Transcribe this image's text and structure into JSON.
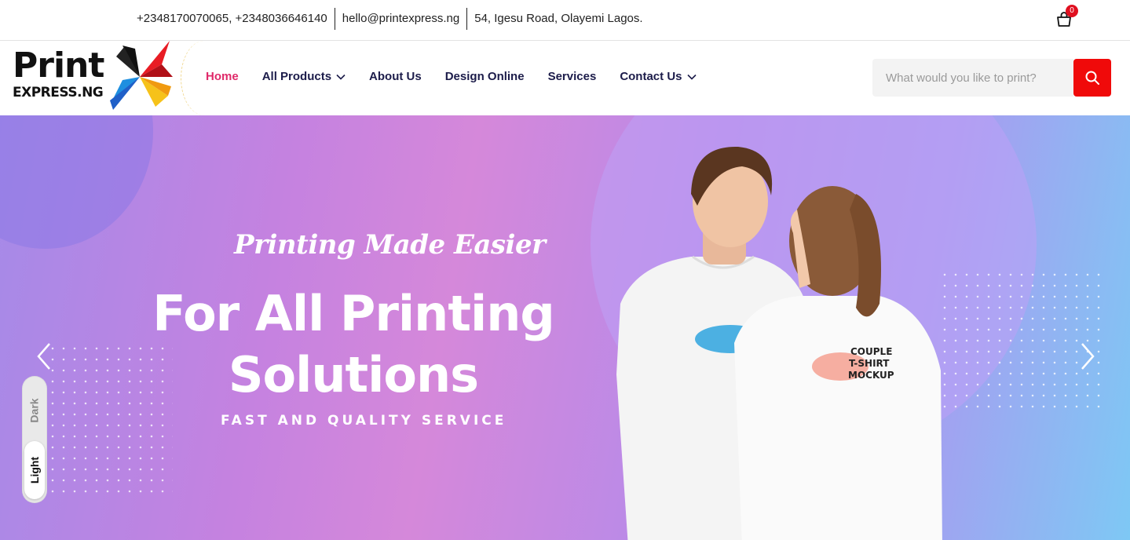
{
  "topbar": {
    "phones": "+2348170070065, +2348036646140",
    "email": "hello@printexpress.ng",
    "address": "54, Igesu Road, Olayemi Lagos.",
    "cart_count": "0"
  },
  "logo": {
    "line1": "Print",
    "line2": "EXPRESS.NG"
  },
  "nav": {
    "items": [
      {
        "label": "Home",
        "active": true,
        "dropdown": false
      },
      {
        "label": "All Products",
        "active": false,
        "dropdown": true
      },
      {
        "label": "About Us",
        "active": false,
        "dropdown": false
      },
      {
        "label": "Design Online",
        "active": false,
        "dropdown": false
      },
      {
        "label": "Services",
        "active": false,
        "dropdown": false
      },
      {
        "label": "Contact Us",
        "active": false,
        "dropdown": true
      }
    ]
  },
  "search": {
    "placeholder": "What would you like to print?"
  },
  "hero": {
    "tagline": "Printing Made Easier",
    "headline_line1": "For All Printing",
    "headline_line2": "Solutions",
    "subline": "FAST AND QUALITY SERVICE",
    "shirt_text_line1": "COUPLE",
    "shirt_text_line2": "T-SHIRT",
    "shirt_text_line3": "MOCKUP"
  },
  "theme_toggle": {
    "dark_label": "Dark",
    "light_label": "Light"
  },
  "colors": {
    "accent_red": "#f00a0a",
    "nav_active": "#e02a6a",
    "nav_text": "#1c1c4a"
  }
}
